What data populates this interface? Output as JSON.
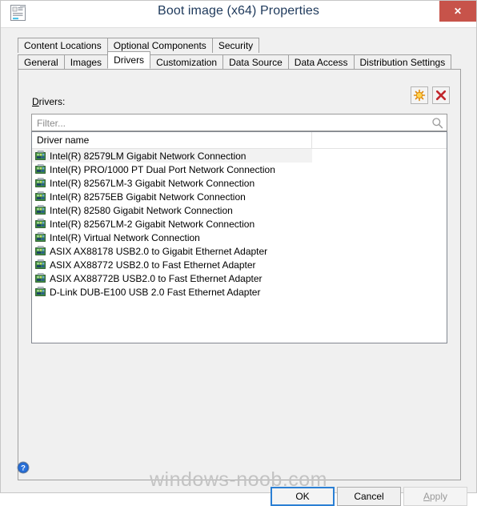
{
  "window": {
    "title": "Boot image (x64) Properties",
    "icon": "boot-image-icon",
    "close_label": "✕"
  },
  "tabs": {
    "row1": [
      {
        "label": "Content Locations",
        "selected": false
      },
      {
        "label": "Optional Components",
        "selected": false
      },
      {
        "label": "Security",
        "selected": false
      }
    ],
    "row2": [
      {
        "label": "General",
        "selected": false
      },
      {
        "label": "Images",
        "selected": false
      },
      {
        "label": "Drivers",
        "selected": true
      },
      {
        "label": "Customization",
        "selected": false
      },
      {
        "label": "Data Source",
        "selected": false
      },
      {
        "label": "Data Access",
        "selected": false
      },
      {
        "label": "Distribution Settings",
        "selected": false
      }
    ]
  },
  "drivers_panel": {
    "label_accel": "D",
    "label_rest": "rivers:",
    "toolbar": {
      "add_label": "add-driver-button",
      "delete_label": "remove-driver-button"
    },
    "filter": {
      "value": "",
      "placeholder": "Filter...",
      "search_icon": "search-icon"
    },
    "list": {
      "columns": [
        "Driver name",
        ""
      ],
      "rows": [
        {
          "name": "Intel(R) 82579LM Gigabit Network Connection",
          "hover": true
        },
        {
          "name": "Intel(R) PRO/1000 PT Dual Port Network Connection",
          "hover": false
        },
        {
          "name": "Intel(R) 82567LM-3 Gigabit Network Connection",
          "hover": false
        },
        {
          "name": "Intel(R) 82575EB Gigabit Network Connection",
          "hover": false
        },
        {
          "name": "Intel(R) 82580 Gigabit Network Connection",
          "hover": false
        },
        {
          "name": "Intel(R) 82567LM-2 Gigabit Network Connection",
          "hover": false
        },
        {
          "name": "Intel(R) Virtual Network Connection",
          "hover": false
        },
        {
          "name": "ASIX AX88178 USB2.0 to Gigabit Ethernet Adapter",
          "hover": false
        },
        {
          "name": "ASIX AX88772 USB2.0 to Fast Ethernet Adapter",
          "hover": false
        },
        {
          "name": "ASIX AX88772B USB2.0 to Fast Ethernet Adapter",
          "hover": false
        },
        {
          "name": "D-Link DUB-E100 USB 2.0 Fast Ethernet Adapter",
          "hover": false
        }
      ]
    }
  },
  "footer": {
    "help_icon": "help-icon",
    "ok_label": "OK",
    "cancel_label": "Cancel",
    "apply_accel": "A",
    "apply_rest": "pply",
    "apply_disabled": true,
    "watermark": "windows-noob.com"
  },
  "colors": {
    "close_red": "#c7534a",
    "title_blue": "#1e395b",
    "focus_blue": "#2a7fd4",
    "window_bg": "#f0f0f0",
    "watermark_gray": "#c3c3c3"
  }
}
